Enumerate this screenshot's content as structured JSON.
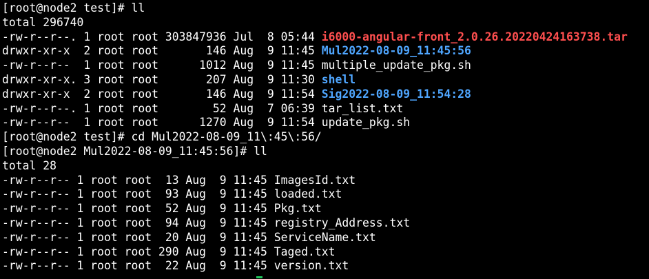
{
  "terminal": {
    "lines": [
      [
        {
          "text": "[root@node2 test]# ll",
          "kind": "plain"
        }
      ],
      [
        {
          "text": "total 296740",
          "kind": "plain"
        }
      ],
      [
        {
          "text": "-rw-r--r--. 1 root root 303847936 Jul  8 05:44 ",
          "kind": "plain"
        },
        {
          "text": "i6000-angular-front_2.0.26.20220424163738.tar",
          "kind": "archive"
        }
      ],
      [
        {
          "text": "drwxr-xr-x  2 root root       146 Aug  9 11:45 ",
          "kind": "plain"
        },
        {
          "text": "Mul2022-08-09_11:45:56",
          "kind": "dir"
        }
      ],
      [
        {
          "text": "-rw-r--r--  1 root root      1012 Aug  9 11:45 multiple_update_pkg.sh",
          "kind": "plain"
        }
      ],
      [
        {
          "text": "drwxr-xr-x. 3 root root       207 Aug  9 11:30 ",
          "kind": "plain"
        },
        {
          "text": "shell",
          "kind": "dir"
        }
      ],
      [
        {
          "text": "drwxr-xr-x  2 root root       146 Aug  9 11:54 ",
          "kind": "plain"
        },
        {
          "text": "Sig2022-08-09_11:54:28",
          "kind": "dir"
        }
      ],
      [
        {
          "text": "-rw-r--r--. 1 root root        52 Aug  7 06:39 tar_list.txt",
          "kind": "plain"
        }
      ],
      [
        {
          "text": "-rw-r--r--  1 root root      1270 Aug  9 11:54 update_pkg.sh",
          "kind": "plain"
        }
      ],
      [
        {
          "text": "[root@node2 test]# cd Mul2022-08-09_11\\:45\\:56/",
          "kind": "plain"
        }
      ],
      [
        {
          "text": "[root@node2 Mul2022-08-09_11:45:56]# ll",
          "kind": "plain"
        }
      ],
      [
        {
          "text": "total 28",
          "kind": "plain"
        }
      ],
      [
        {
          "text": "-rw-r--r-- 1 root root  13 Aug  9 11:45 ImagesId.txt",
          "kind": "plain"
        }
      ],
      [
        {
          "text": "-rw-r--r-- 1 root root  93 Aug  9 11:45 loaded.txt",
          "kind": "plain"
        }
      ],
      [
        {
          "text": "-rw-r--r-- 1 root root  52 Aug  9 11:45 Pkg.txt",
          "kind": "plain"
        }
      ],
      [
        {
          "text": "-rw-r--r-- 1 root root  94 Aug  9 11:45 registry_Address.txt",
          "kind": "plain"
        }
      ],
      [
        {
          "text": "-rw-r--r-- 1 root root  20 Aug  9 11:45 ServiceName.txt",
          "kind": "plain"
        }
      ],
      [
        {
          "text": "-rw-r--r-- 1 root root 290 Aug  9 11:45 Taged.txt",
          "kind": "plain"
        }
      ],
      [
        {
          "text": "-rw-r--r-- 1 root root  22 Aug  9 11:45 version.txt",
          "kind": "plain"
        }
      ]
    ],
    "colors": {
      "background": "#000000",
      "text": "#ffffff",
      "archive": "#ff4f4f",
      "directory": "#4fa6ff",
      "cursor": "#22c55e"
    }
  }
}
